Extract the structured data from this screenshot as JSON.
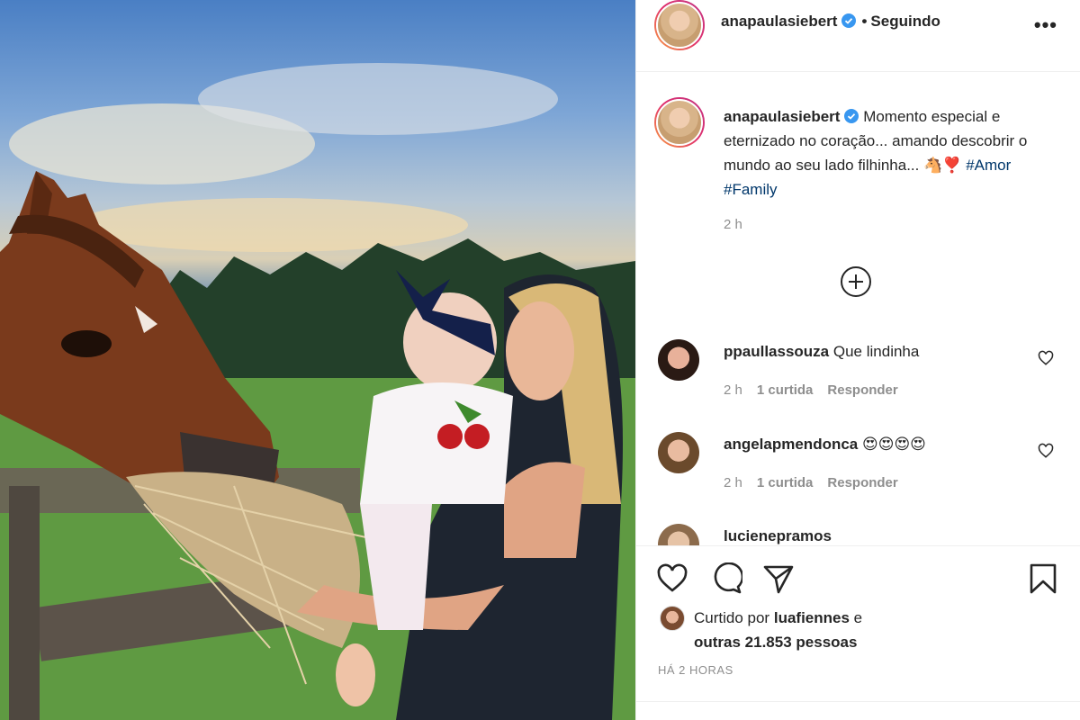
{
  "header": {
    "username": "anapaulasiebert",
    "separator": "•",
    "follow_status": "Seguindo",
    "more_label": "•••"
  },
  "caption": {
    "username": "anapaulasiebert",
    "text": "Momento especial e eternizado no coração... amando descobrir o mundo ao seu lado filhinha...",
    "emojis": "🐴❣️",
    "hashtags": [
      "#Amor",
      "#Family"
    ],
    "time": "2 h"
  },
  "comments": [
    {
      "username": "ppaullassouza",
      "text": "Que lindinha",
      "time": "2 h",
      "likes": "1 curtida",
      "reply": "Responder"
    },
    {
      "username": "angelapmendonca",
      "text": "😍😍😍😍",
      "time": "2 h",
      "likes": "1 curtida",
      "reply": "Responder"
    },
    {
      "username": "lucienepramos"
    }
  ],
  "likes": {
    "prefix": "Curtido por",
    "user": "luafiennes",
    "conjunction": "e",
    "others": "outras 21.853 pessoas"
  },
  "post_time": "HÁ 2 HORAS",
  "icons": [
    "heart-icon",
    "comment-icon",
    "share-icon",
    "bookmark-icon",
    "verified-icon",
    "add-comments-icon"
  ],
  "colors": {
    "link": "#00376b",
    "verified": "#3897f0",
    "muted": "#8e8e8e"
  }
}
